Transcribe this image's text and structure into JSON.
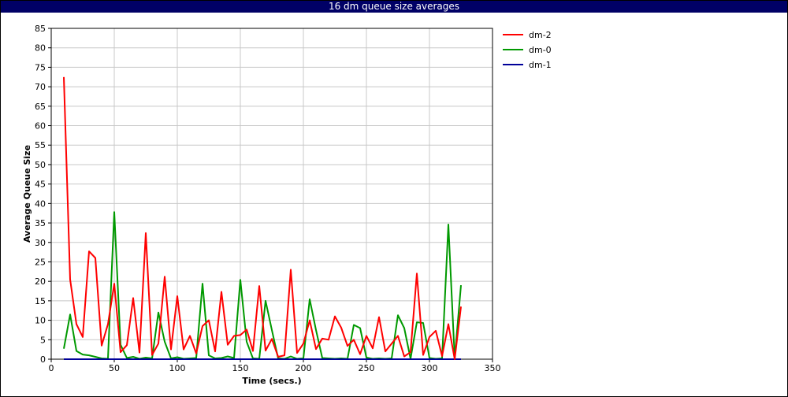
{
  "chart_data": {
    "type": "line",
    "title": "16 dm queue size averages",
    "xlabel": "Time (secs.)",
    "ylabel": "Average Queue Size",
    "xlim": [
      0,
      350
    ],
    "ylim": [
      0,
      85
    ],
    "xticks": [
      0,
      50,
      100,
      150,
      200,
      250,
      300,
      350
    ],
    "yticks": [
      0,
      5,
      10,
      15,
      20,
      25,
      30,
      35,
      40,
      45,
      50,
      55,
      60,
      65,
      70,
      75,
      80,
      85
    ],
    "grid": true,
    "legend": "right",
    "x": [
      10,
      15,
      20,
      25,
      30,
      35,
      40,
      45,
      50,
      55,
      60,
      65,
      70,
      75,
      80,
      85,
      90,
      95,
      100,
      105,
      110,
      115,
      120,
      125,
      130,
      135,
      140,
      145,
      150,
      155,
      160,
      165,
      170,
      175,
      180,
      185,
      190,
      195,
      200,
      205,
      210,
      215,
      220,
      225,
      230,
      235,
      240,
      245,
      250,
      255,
      260,
      265,
      270,
      275,
      280,
      285,
      290,
      295,
      300,
      305,
      310,
      315,
      320,
      325
    ],
    "series": [
      {
        "name": "dm-2",
        "color": "#ff0000",
        "values": [
          72.5,
          20.5,
          9.0,
          5.7,
          27.7,
          26.0,
          3.5,
          9.0,
          19.4,
          1.8,
          3.6,
          15.7,
          1.7,
          32.4,
          1.1,
          4.0,
          21.2,
          2.5,
          16.2,
          2.5,
          6.0,
          1.5,
          8.5,
          10.0,
          2.0,
          17.3,
          3.7,
          6.0,
          6.2,
          7.6,
          2.1,
          18.8,
          2.2,
          5.2,
          0.6,
          1.0,
          23.0,
          1.6,
          4.0,
          10.0,
          2.6,
          5.3,
          5.0,
          11.0,
          8.1,
          3.4,
          5.0,
          1.3,
          6.0,
          2.8,
          10.8,
          2.0,
          4.0,
          6.0,
          0.7,
          1.8,
          22.0,
          1.1,
          5.7,
          7.3,
          0.8,
          9.0,
          0.0,
          13.5
        ]
      },
      {
        "name": "dm-0",
        "color": "#009900",
        "values": [
          2.7,
          11.5,
          2.1,
          1.2,
          1.0,
          0.6,
          0.2,
          0.1,
          37.8,
          3.7,
          0.3,
          0.6,
          0.1,
          0.4,
          0.2,
          12.0,
          4.5,
          0.2,
          0.5,
          0.1,
          0.2,
          0.3,
          19.4,
          1.0,
          0.2,
          0.3,
          0.7,
          0.3,
          20.4,
          4.5,
          0.2,
          0.1,
          15.0,
          7.5,
          0.2,
          0.1,
          0.7,
          0.1,
          0.2,
          15.4,
          7.5,
          0.3,
          0.2,
          0.1,
          0.2,
          0.1,
          8.8,
          8.0,
          0.4,
          0.1,
          0.2,
          0.1,
          0.2,
          11.3,
          8.0,
          0.1,
          9.5,
          9.3,
          0.3,
          0.1,
          0.2,
          34.6,
          0.2,
          19.0
        ]
      },
      {
        "name": "dm-1",
        "color": "#000099",
        "values": [
          0,
          0,
          0,
          0,
          0,
          0,
          0,
          0,
          0,
          0,
          0,
          0,
          0,
          0,
          0,
          0,
          0,
          0,
          0,
          0,
          0,
          0,
          0,
          0,
          0,
          0,
          0,
          0,
          0,
          0,
          0,
          0,
          0,
          0,
          0,
          0,
          0,
          0,
          0,
          0,
          0,
          0,
          0,
          0,
          0,
          0,
          0,
          0,
          0,
          0,
          0,
          0,
          0,
          0,
          0,
          0,
          0,
          0,
          0,
          0,
          0,
          0,
          0,
          0
        ]
      }
    ]
  }
}
